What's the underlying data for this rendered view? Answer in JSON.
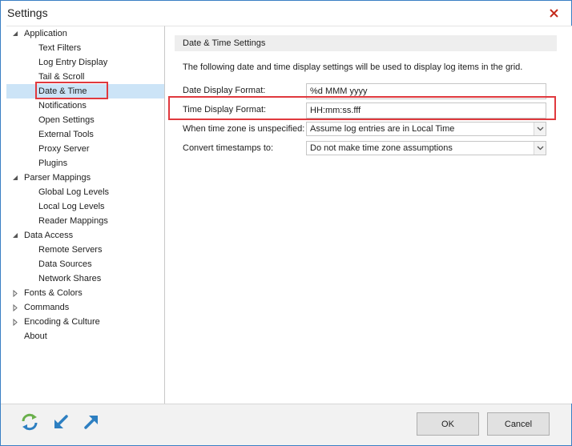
{
  "window": {
    "title": "Settings"
  },
  "tree": [
    {
      "label": "Application",
      "level": 0,
      "expander": "expanded"
    },
    {
      "label": "Text Filters",
      "level": 1
    },
    {
      "label": "Log Entry Display",
      "level": 1
    },
    {
      "label": "Tail & Scroll",
      "level": 1
    },
    {
      "label": "Date & Time",
      "level": 1,
      "selected": true
    },
    {
      "label": "Notifications",
      "level": 1
    },
    {
      "label": "Open Settings",
      "level": 1
    },
    {
      "label": "External Tools",
      "level": 1
    },
    {
      "label": "Proxy Server",
      "level": 1
    },
    {
      "label": "Plugins",
      "level": 1
    },
    {
      "label": "Parser Mappings",
      "level": 0,
      "expander": "expanded"
    },
    {
      "label": "Global Log Levels",
      "level": 1
    },
    {
      "label": "Local Log Levels",
      "level": 1
    },
    {
      "label": "Reader Mappings",
      "level": 1
    },
    {
      "label": "Data Access",
      "level": 0,
      "expander": "expanded"
    },
    {
      "label": "Remote Servers",
      "level": 1
    },
    {
      "label": "Data Sources",
      "level": 1
    },
    {
      "label": "Network Shares",
      "level": 1
    },
    {
      "label": "Fonts & Colors",
      "level": 0,
      "expander": "collapsed"
    },
    {
      "label": "Commands",
      "level": 0,
      "expander": "collapsed"
    },
    {
      "label": "Encoding & Culture",
      "level": 0,
      "expander": "collapsed"
    },
    {
      "label": "About",
      "level": 0
    }
  ],
  "panel": {
    "header": "Date & Time Settings",
    "description": "The following date and time display settings will be used to display log items in the grid.",
    "date_format": {
      "label": "Date Display Format:",
      "value": "%d MMM yyyy"
    },
    "time_format": {
      "label": "Time Display Format:",
      "value": "HH:mm:ss.fff"
    },
    "timezone": {
      "label": "When time zone is unspecified:",
      "value": "Assume log entries are in Local Time"
    },
    "convert": {
      "label": "Convert timestamps to:",
      "value": "Do not make time zone assumptions"
    }
  },
  "footer": {
    "ok_label": "OK",
    "cancel_label": "Cancel",
    "icons": [
      "refresh-icon",
      "import-icon",
      "export-icon"
    ]
  },
  "colors": {
    "accent": "#3a7fc4",
    "highlight": "#e0393e",
    "selection": "#cce4f7",
    "close": "#c42b1c"
  }
}
